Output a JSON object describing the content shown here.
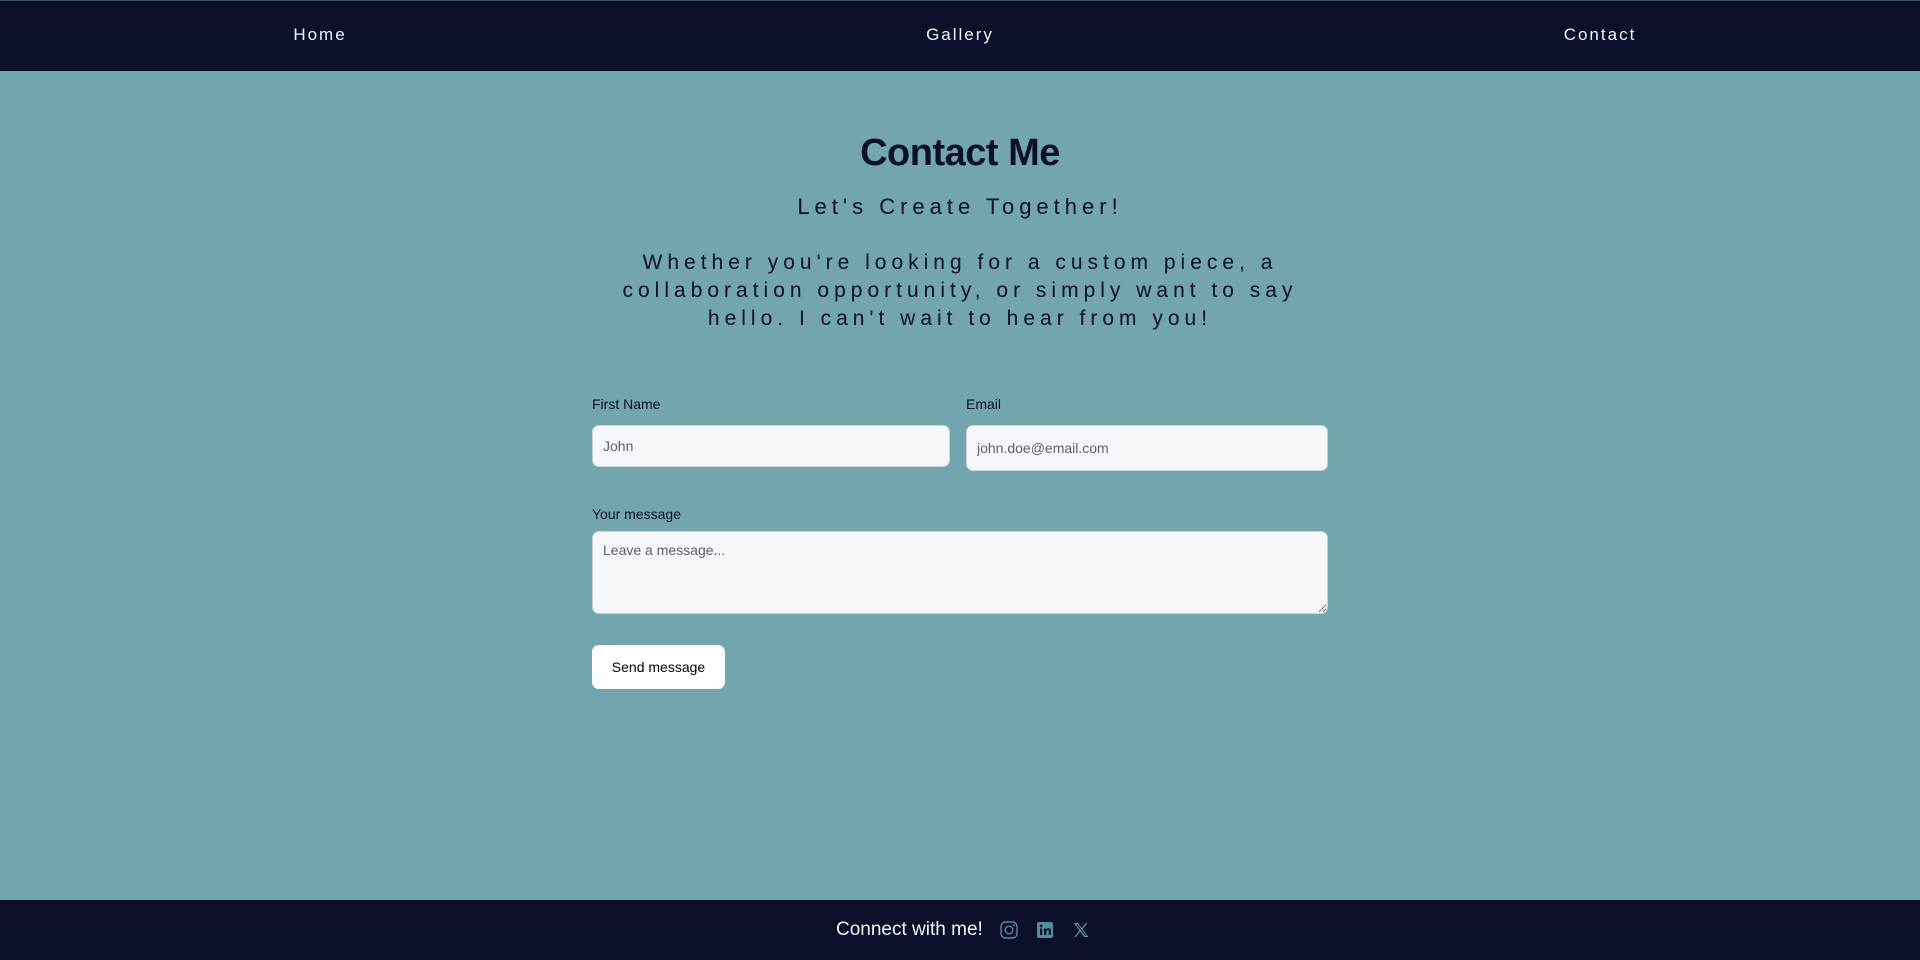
{
  "nav": {
    "items": [
      {
        "label": "Home"
      },
      {
        "label": "Gallery"
      },
      {
        "label": "Contact"
      }
    ]
  },
  "main": {
    "title": "Contact Me",
    "subtitle": "Let's Create Together!",
    "intro": "Whether you're looking for a custom piece, a collaboration opportunity, or simply want to say hello. I can't wait to hear from you!"
  },
  "form": {
    "first_name": {
      "label": "First Name",
      "placeholder": "John"
    },
    "email": {
      "label": "Email",
      "placeholder": "john.doe@email.com"
    },
    "message": {
      "label": "Your message",
      "placeholder": "Leave a message..."
    },
    "submit_label": "Send message"
  },
  "footer": {
    "text": "Connect with me!",
    "icons": [
      "instagram-icon",
      "linkedin-icon",
      "x-icon"
    ]
  },
  "colors": {
    "background": "#72a5ae",
    "nav_footer": "#0b0f2a",
    "text_dark": "#0b0f2a",
    "input_bg": "#f6f7fa",
    "button_bg": "#ffffff"
  }
}
